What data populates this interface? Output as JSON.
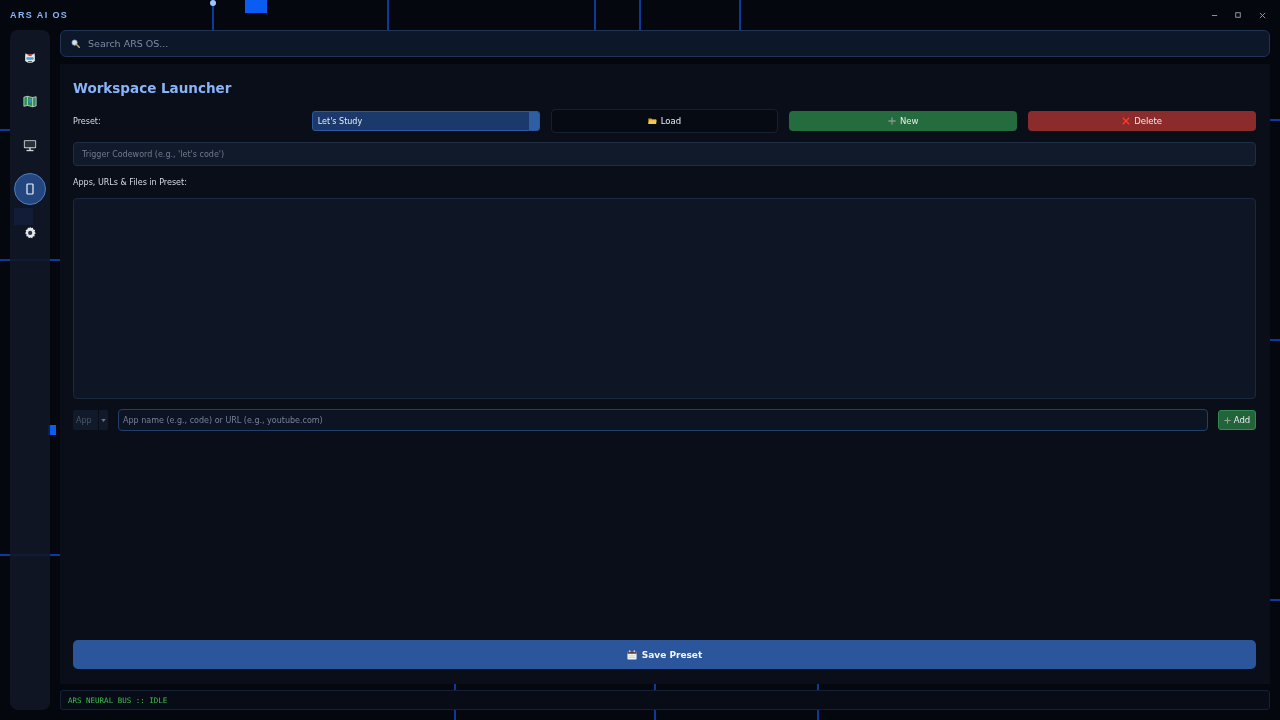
{
  "window": {
    "title": "ARS AI OS"
  },
  "sidebar": {
    "items": [
      {
        "selected": false
      },
      {
        "selected": false
      },
      {
        "selected": false
      },
      {
        "selected": true
      },
      {
        "selected": false
      }
    ]
  },
  "search": {
    "placeholder": "Search ARS OS..."
  },
  "panel": {
    "title": "Workspace Launcher",
    "preset": {
      "label": "Preset:",
      "value": "Let's Study"
    },
    "buttons": [
      {
        "label": "Load",
        "kind": "neutral"
      },
      {
        "label": "New",
        "kind": "create"
      },
      {
        "label": "Delete",
        "kind": "danger"
      }
    ],
    "trigger": {
      "placeholder": "Trigger Codeword (e.g., 'let's code')"
    },
    "items_label": "Apps, URLs & Files in Preset:",
    "add_row": {
      "type": {
        "value": "App",
        "disabled": true
      },
      "placeholder": "App name (e.g., code) or URL (e.g., youtube.com)",
      "button": "Add"
    },
    "save_button": "Save Preset"
  },
  "status_bar": {
    "text": "ARS NEURAL BUS :: IDLE"
  }
}
